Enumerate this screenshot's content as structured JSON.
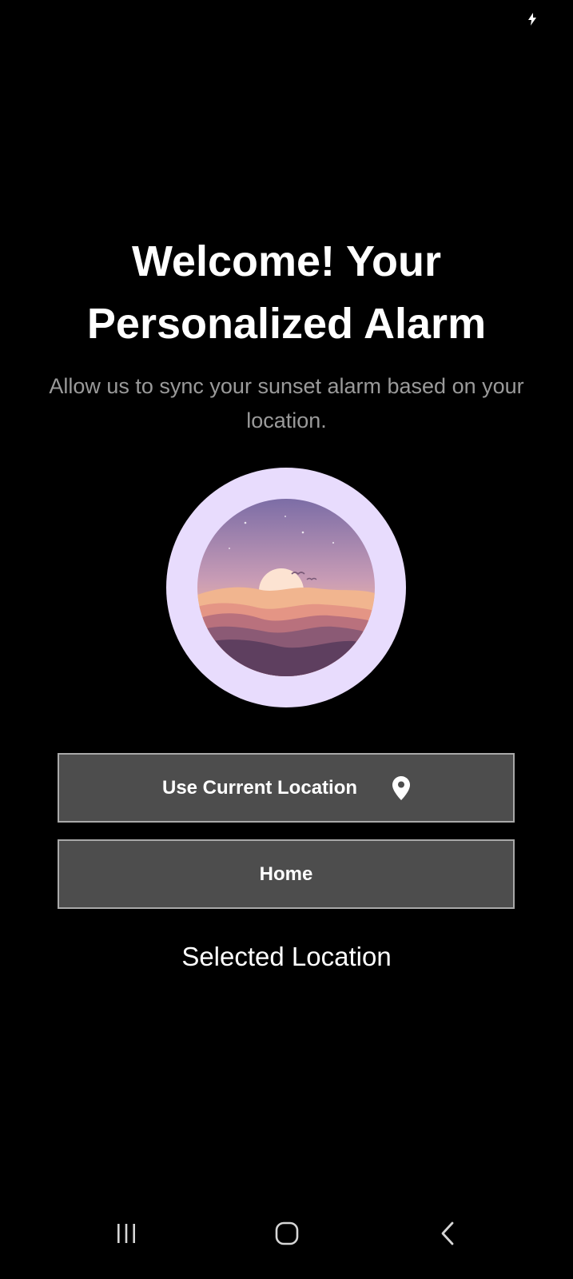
{
  "status_bar": {
    "icons": [
      "charging-bolt-icon"
    ]
  },
  "welcome": {
    "title_line1": "Welcome! Your",
    "title_line2": "Personalized Alarm",
    "subtitle_line1": "Allow us to sync your sunset alarm based on your",
    "subtitle_line2": "location."
  },
  "illustration": {
    "icon": "sunset-landscape-illustration",
    "ring_color": "#e8dcfd"
  },
  "buttons": {
    "use_current_location": "Use Current Location",
    "use_current_location_icon": "map-pin-icon",
    "home": "Home",
    "background": "#4d4d4d",
    "border": "#a9a9a9"
  },
  "selected_location": {
    "label": "Selected Location"
  },
  "nav_bar": {
    "icons": [
      "recents-icon",
      "home-icon",
      "back-icon"
    ]
  },
  "colors": {
    "background": "#000000",
    "text_primary": "#ffffff",
    "text_secondary": "#9a9a9a"
  }
}
